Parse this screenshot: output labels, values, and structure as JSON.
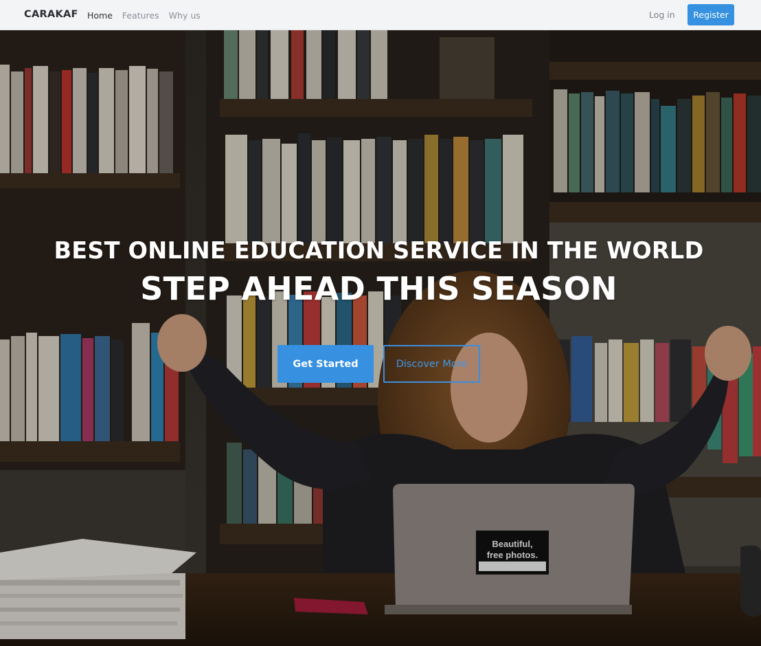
{
  "nav": {
    "brand": "CARAKAF",
    "links": [
      {
        "label": "Home",
        "active": true
      },
      {
        "label": "Features",
        "active": false
      },
      {
        "label": "Why us",
        "active": false
      }
    ],
    "login_label": "Log in",
    "register_label": "Register"
  },
  "hero": {
    "headline": "BEST ONLINE EDUCATION SERVICE IN THE WORLD",
    "subheadline": "STEP AHEAD THIS SEASON",
    "primary_cta": "Get Started",
    "secondary_cta": "Discover More",
    "laptop_sticker": [
      "Beautiful,",
      "free photos."
    ],
    "background_description_icon": "photo-background"
  },
  "colors": {
    "accent": "#3691e0",
    "navbar_bg": "#f3f4f6",
    "brand_text": "#2b2d31",
    "hero_text": "#ffffff"
  }
}
